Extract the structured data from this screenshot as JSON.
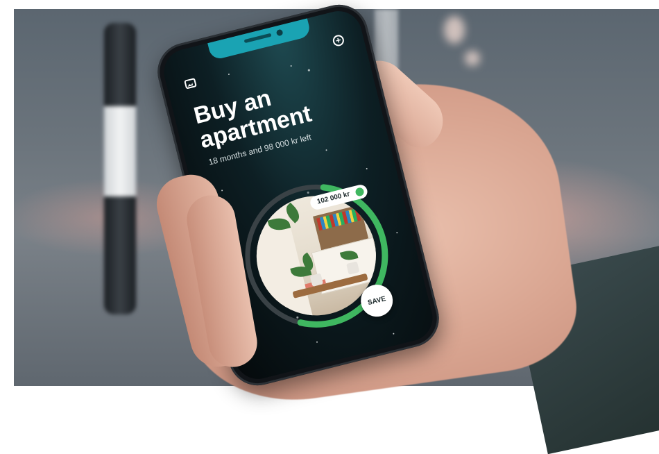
{
  "screen": {
    "title": "Buy an apartment",
    "subtitle": "18 months and 98 000 kr left",
    "saved_amount": "102 000 kr",
    "save_label": "SAVE",
    "progress": 0.52,
    "icons": {
      "top_left": "gallery-icon",
      "top_right": "add-icon",
      "status_dot": "status-dot"
    },
    "colors": {
      "progress": "#3fb760",
      "track": "#3a4246",
      "notch": "#1aa3b3"
    }
  }
}
